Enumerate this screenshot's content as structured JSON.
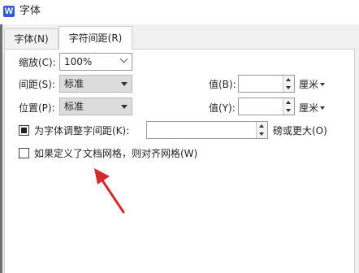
{
  "window": {
    "app_icon_letter": "W",
    "title": "字体"
  },
  "tabs": [
    {
      "label": "字体(N)",
      "active": false
    },
    {
      "label": "字符间距(R)",
      "active": true
    }
  ],
  "form": {
    "scale": {
      "label": "缩放(C):",
      "value": "100%"
    },
    "spacing": {
      "label": "间距(S):",
      "value": "标准",
      "value_label": "值(B):",
      "value_field": "",
      "unit": "厘米"
    },
    "position": {
      "label": "位置(P):",
      "value": "标准",
      "value_label": "值(Y):",
      "value_field": "",
      "unit": "厘米"
    },
    "kerning": {
      "checked": true,
      "label": "为字体调整字间距(K):",
      "value_field": "",
      "suffix": "磅或更大(O)"
    },
    "grid": {
      "checked": false,
      "label": "如果定义了文档网格，则对齐网格(W)"
    }
  },
  "colors": {
    "annotation_arrow": "#d42a2a",
    "app_icon": "#2f5bd6"
  }
}
